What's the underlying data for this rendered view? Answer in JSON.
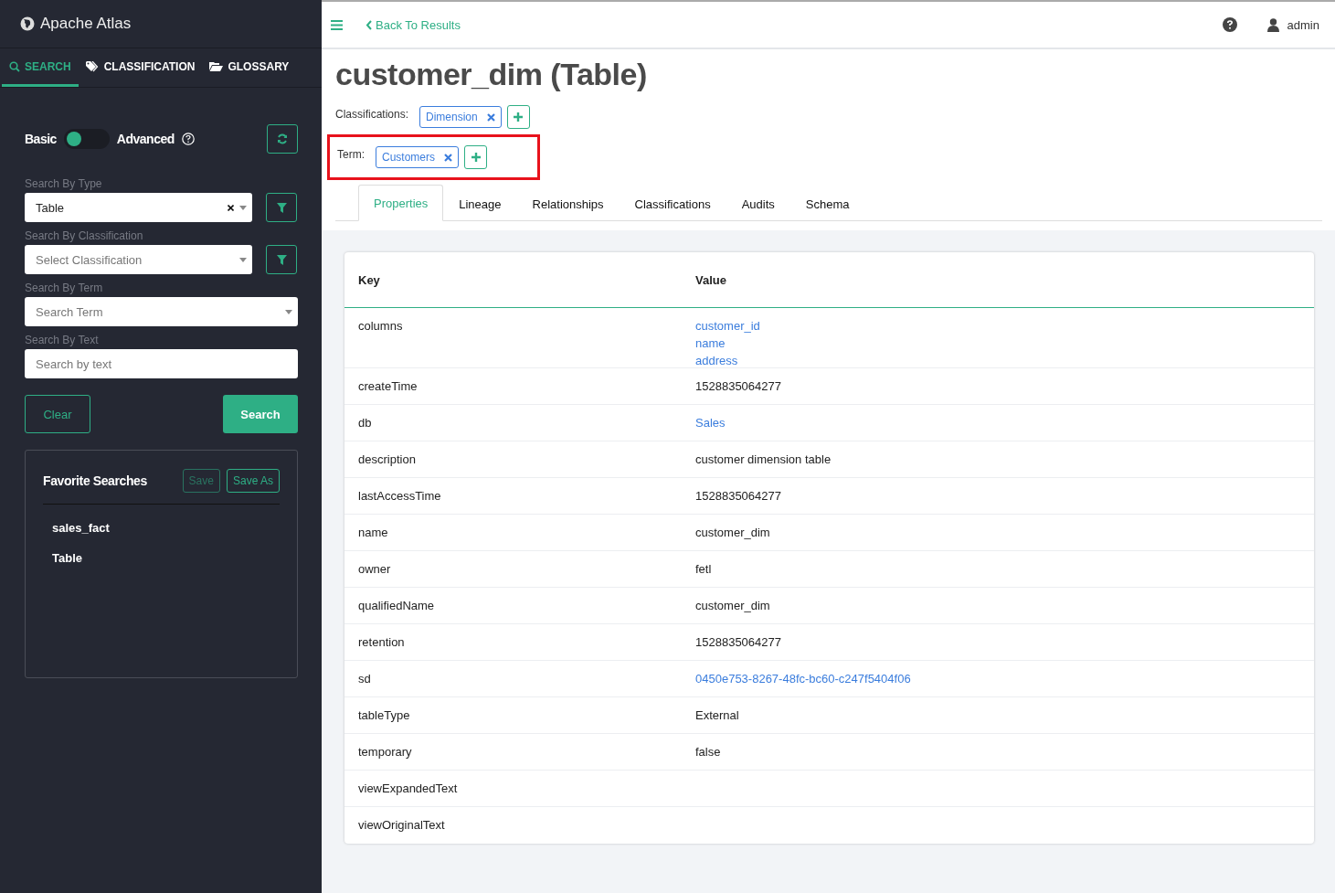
{
  "app": {
    "title": "Apache Atlas"
  },
  "nav_tabs": [
    {
      "label": "SEARCH",
      "selected": true
    },
    {
      "label": "CLASSIFICATION",
      "selected": false
    },
    {
      "label": "GLOSSARY",
      "selected": false
    }
  ],
  "mode_switch": {
    "left_label": "Basic",
    "right_label": "Advanced",
    "on": false
  },
  "filters": [
    {
      "label": "Search By Type",
      "value": "Table",
      "clearable": true,
      "filter_button": true
    },
    {
      "label": "Search By Classification",
      "placeholder": "Select Classification",
      "clearable": false,
      "filter_button": true
    },
    {
      "label": "Search By Term",
      "placeholder": "Search Term",
      "clearable": false,
      "filter_button": false
    }
  ],
  "text_search": {
    "label": "Search By Text",
    "placeholder": "Search by text"
  },
  "buttons": {
    "clear": "Clear",
    "search": "Search"
  },
  "favorites": {
    "title": "Favorite Searches",
    "save": "Save",
    "save_as": "Save As",
    "items": [
      "sales_fact",
      "Table"
    ]
  },
  "header": {
    "back": "Back To Results",
    "user": "admin"
  },
  "entity": {
    "title": "customer_dim (Table)",
    "classifications_label": "Classifications:",
    "classifications": [
      "Dimension"
    ],
    "term_label": "Term:",
    "terms": [
      "Customers"
    ],
    "term_highlighted": true
  },
  "detail_tabs": [
    {
      "label": "Properties",
      "selected": true
    },
    {
      "label": "Lineage",
      "selected": false
    },
    {
      "label": "Relationships",
      "selected": false
    },
    {
      "label": "Classifications",
      "selected": false
    },
    {
      "label": "Audits",
      "selected": false
    },
    {
      "label": "Schema",
      "selected": false
    }
  ],
  "table": {
    "columns": [
      "Key",
      "Value"
    ],
    "rows": [
      {
        "key": "columns",
        "values": [
          {
            "text": "customer_id",
            "link": true
          },
          {
            "text": "name",
            "link": true
          },
          {
            "text": "address",
            "link": true
          }
        ]
      },
      {
        "key": "createTime",
        "values": [
          {
            "text": "1528835064277",
            "link": false
          }
        ]
      },
      {
        "key": "db",
        "values": [
          {
            "text": "Sales",
            "link": true
          }
        ]
      },
      {
        "key": "description",
        "values": [
          {
            "text": "customer dimension table",
            "link": false
          }
        ]
      },
      {
        "key": "lastAccessTime",
        "values": [
          {
            "text": "1528835064277",
            "link": false
          }
        ]
      },
      {
        "key": "name",
        "values": [
          {
            "text": "customer_dim",
            "link": false
          }
        ]
      },
      {
        "key": "owner",
        "values": [
          {
            "text": "fetl",
            "link": false
          }
        ]
      },
      {
        "key": "qualifiedName",
        "values": [
          {
            "text": "customer_dim",
            "link": false
          }
        ]
      },
      {
        "key": "retention",
        "values": [
          {
            "text": "1528835064277",
            "link": false
          }
        ]
      },
      {
        "key": "sd",
        "values": [
          {
            "text": "0450e753-8267-48fc-bc60-c247f5404f06",
            "link": true
          }
        ]
      },
      {
        "key": "tableType",
        "values": [
          {
            "text": "External",
            "link": false
          }
        ]
      },
      {
        "key": "temporary",
        "values": [
          {
            "text": "false",
            "link": false
          }
        ]
      },
      {
        "key": "viewExpandedText",
        "values": []
      },
      {
        "key": "viewOriginalText",
        "values": []
      }
    ]
  }
}
